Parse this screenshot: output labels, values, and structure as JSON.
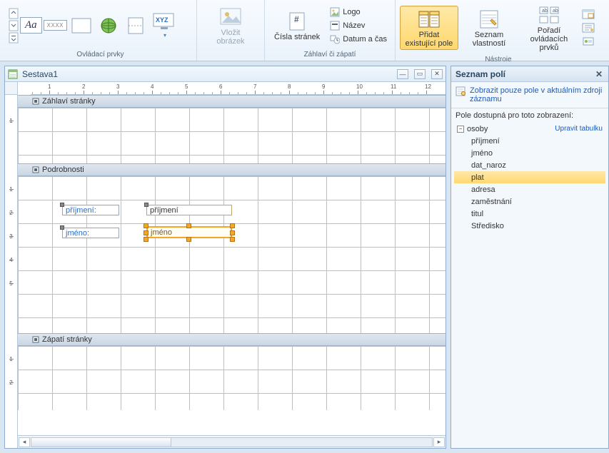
{
  "ribbon": {
    "groups": {
      "controls": {
        "label": "Ovládací prvky"
      },
      "insert_image": {
        "label": "Vložit obrázek"
      },
      "header_footer": {
        "label": "Záhlaví či zápatí",
        "page_numbers": "Čísla stránek",
        "logo": "Logo",
        "title": "Název",
        "datetime": "Datum a čas"
      },
      "tools": {
        "label": "Nástroje",
        "add_existing": "Přidat existující pole",
        "field_list": "Seznam vlastností",
        "tab_order": "Pořadí ovládacích prvků"
      }
    },
    "aa": "Aa",
    "xxx": "XXXX"
  },
  "doc": {
    "title": "Sestava1",
    "bands": {
      "page_header": "Záhlaví stránky",
      "detail": "Podrobnosti",
      "page_footer": "Zápatí stránky"
    },
    "controls": {
      "label1": "příjmení:",
      "field1": "příjmení",
      "label2": "jméno:",
      "field2": "jméno"
    }
  },
  "panel": {
    "title": "Seznam polí",
    "link": "Zobrazit pouze pole v aktuálním zdroji záznamu",
    "available": "Pole dostupná pro toto zobrazení:",
    "table": "osoby",
    "edit": "Upravit tabulku",
    "fields": [
      "příjmení",
      "jméno",
      "dat_naroz",
      "plat",
      "adresa",
      "zaměstnání",
      "titul",
      "Středisko"
    ],
    "highlight_index": 3
  },
  "ruler": {
    "h": [
      "1",
      "2",
      "3",
      "4",
      "5",
      "6",
      "7",
      "8",
      "9",
      "10",
      "11",
      "12"
    ],
    "v": {
      "header": [
        "1"
      ],
      "detail": [
        "1",
        "2",
        "3",
        "4",
        "5"
      ],
      "footer": [
        "1",
        "2"
      ]
    }
  }
}
